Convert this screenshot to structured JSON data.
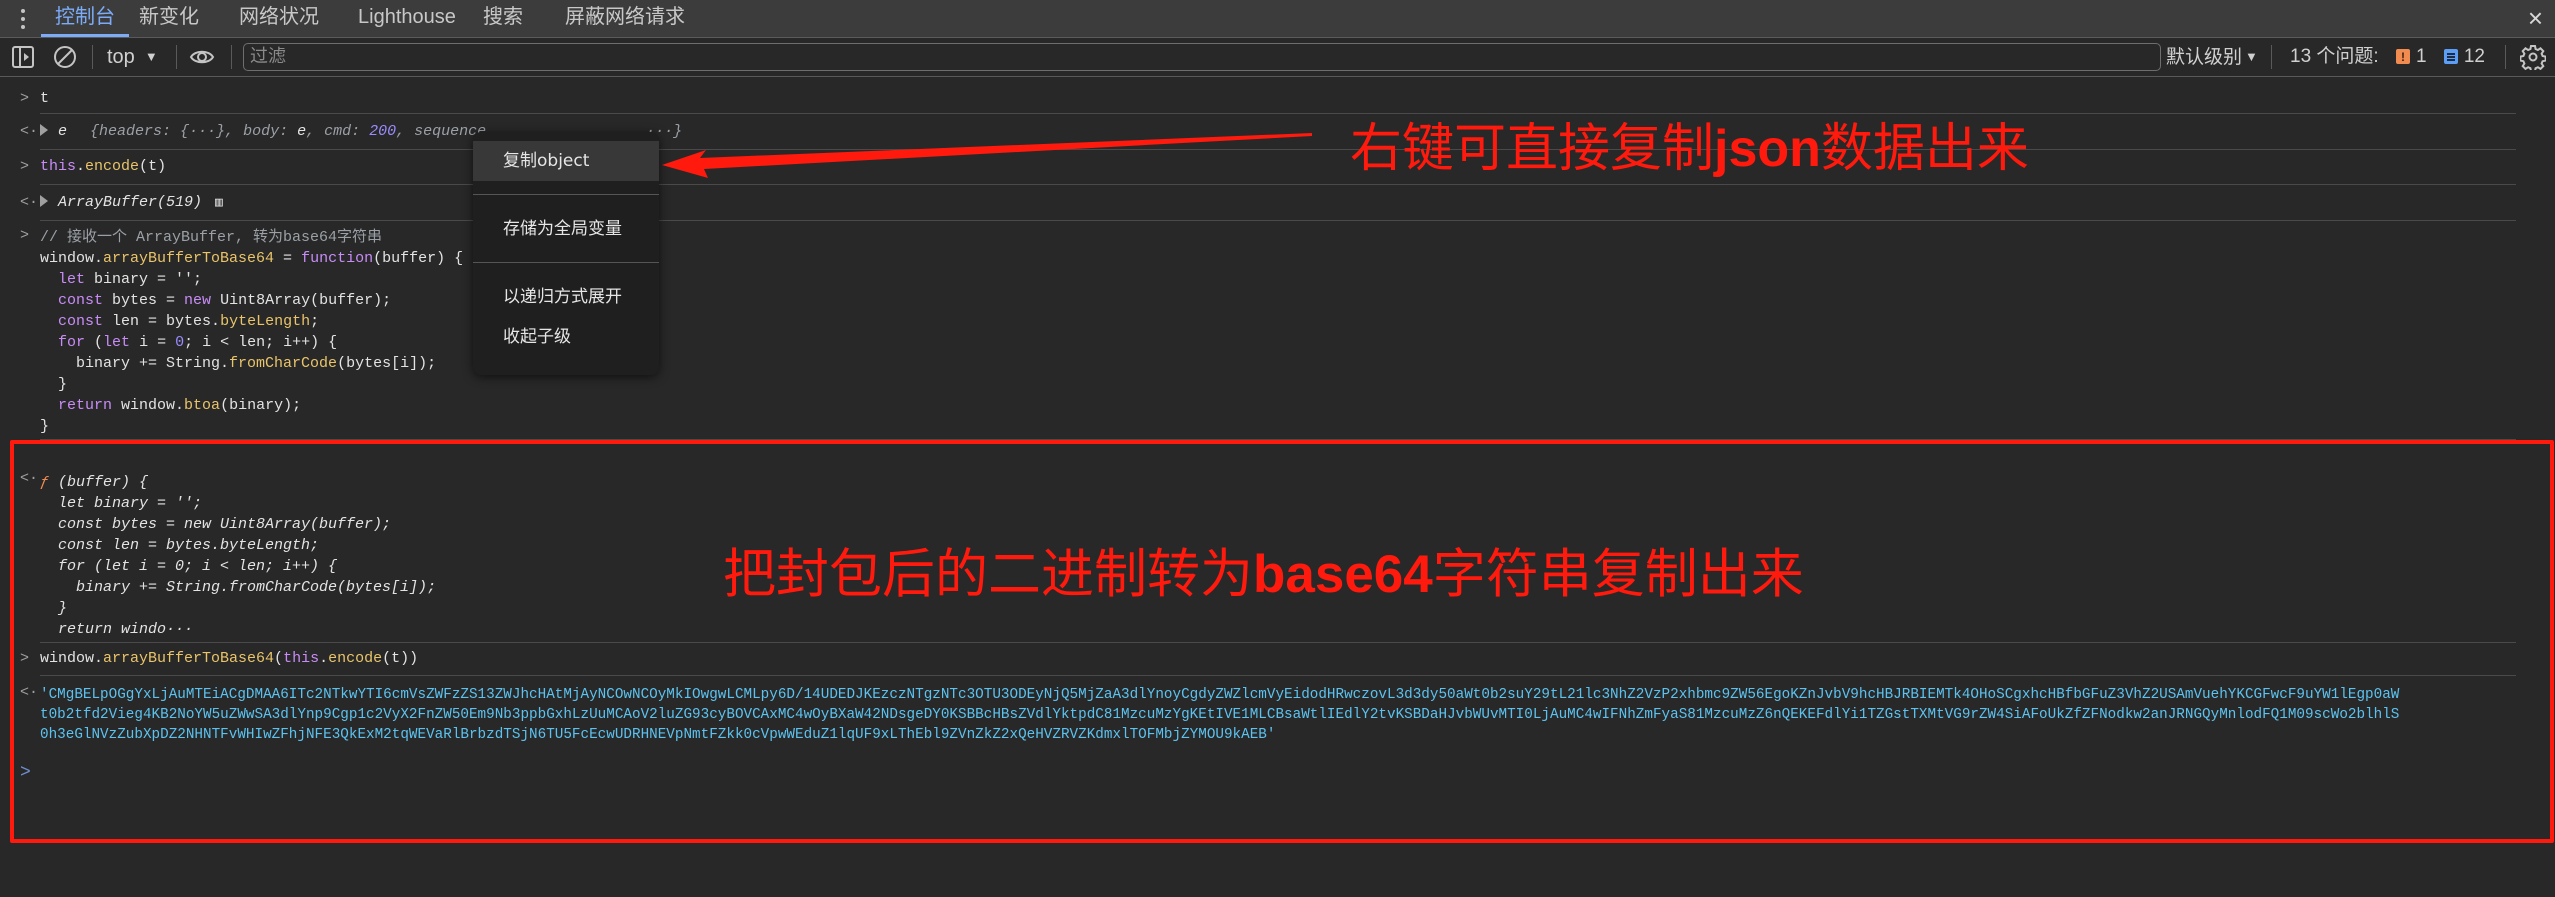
{
  "tabbar": {
    "tabs": [
      {
        "label": "控制台",
        "active": true
      },
      {
        "label": "新变化",
        "active": false
      },
      {
        "label": "网络状况",
        "active": false
      },
      {
        "label": "Lighthouse",
        "active": false
      },
      {
        "label": "搜索",
        "active": false
      },
      {
        "label": "屏蔽网络请求",
        "active": false
      }
    ],
    "close_icon": "×"
  },
  "toolbar": {
    "context": "top",
    "filter_placeholder": "过滤",
    "filter_value": "",
    "levels": "默认级别",
    "issues_label": "13 个问题:",
    "issues_error_count": "1",
    "issues_info_count": "12"
  },
  "console": {
    "rows": [
      {
        "type": "input",
        "text": "t"
      },
      {
        "type": "output",
        "name": "e",
        "preview_parts": [
          "{headers: {···}, ",
          "body: ",
          "e",
          ", cmd: ",
          "200",
          ", sequence",
          "···}"
        ]
      },
      {
        "type": "input",
        "code": {
          "obj": "this",
          "method": "encode",
          "arg": "t"
        }
      },
      {
        "type": "output",
        "text": "ArrayBuffer(519)"
      }
    ],
    "code_comment": "// 接收一个 ArrayBuffer, 转为base64字符串",
    "code_lines": [
      "window.arrayBufferToBase64 = function(buffer) {",
      "  let binary = '';",
      "  const bytes = new Uint8Array(buffer);",
      "  const len = bytes.byteLength;",
      "  for (let i = 0; i < len; i++) {",
      "    binary += String.fromCharCode(bytes[i]);",
      "  }",
      "  return window.btoa(binary);",
      "}"
    ],
    "fn_result_head": "ƒ (buffer) {",
    "fn_result_lines": [
      "  let binary = '';",
      "  const bytes = new Uint8Array(buffer);",
      "  const len = bytes.byteLength;",
      "  for (let i = 0; i < len; i++) {",
      "    binary += String.fromCharCode(bytes[i]);",
      "  }",
      "  return windo···"
    ],
    "call_input": "window.arrayBufferToBase64(this.encode(t))",
    "base64_lines": [
      "'CMgBELpOGgYxLjAuMTEiACgDMAA6ITc2NTkwYTI6cmVsZWFzZS13ZWJhcHAtMjAyNCOwNCOyMkIOwgwLCMLpy6D/14UDEDJKEzczNTgzNTc3OTU3ODEyNjQ5MjZaA3dlYnoyCgdyZWZlcmVyEidodHRwczovL3d3dy50aWt0b2suY29tL21lc3NhZ2VzP2xhbmc9ZW56EgoKZnJvbV9hcHBJRBIEMTk4OHoSCgxhcHBfbGFuZ3VhZ2USAmVuehYKCGFwcF9uYW1lEgp0aW",
      "t0b2tfd2Vieg4KB2NoYW5uZWwSA3dlYnp9Cgp1c2VyX2FnZW50Em9Nb3ppbGxhLzUuMCAoV2luZG93cyBOVCAxMC4wOyBXaW42NDsgeDY0KSBBcHBsZVdlYktpdC81MzcuMzYgKEtIVE1MLCBsaWtlIEdlY2tvKSBDaHJvbWUvMTI0LjAuMC4wIFNhZmFyaS81MzcuMzZ6nQEKEFdlYi1TZGstTXMtVG9rZW4SiAFoUkZfZFNodkw2anJRNGQyMnlodFQ1M09scWo2blhlS",
      "0h3eGlNVzZubXpDZ2NHNTFvWHIwZFhjNFE3QkExM2tqWEVaRlBrbzdTSjN6TU5FcEcwUDRHNEVpNmtFZkk0cVpwWEduZ1lqUF9xLThEbl9ZVnZkZ2xQeHVZRVZKdmxlTOFMbjZYMOU9kAEB'"
    ],
    "prompt": ">"
  },
  "context_menu": {
    "items": [
      "复制object",
      "存储为全局变量",
      "以递归方式展开",
      "收起子级"
    ],
    "highlighted": "复制object"
  },
  "annotations": {
    "top_prefix": "右键可直接复制",
    "top_bold": "json",
    "top_suffix": "数据出来",
    "bottom_prefix": "把封包后的二进制转为",
    "bottom_bold": "base64",
    "bottom_suffix": "字符串复制出来",
    "color": "#ff1a0d"
  },
  "colors": {
    "accent": "#7cacf8",
    "keyword": "#c98cf7",
    "function": "#e9c46a",
    "string": "#5cc3f0",
    "number": "#9a8cff",
    "annotation_red": "#ff1a0d"
  }
}
